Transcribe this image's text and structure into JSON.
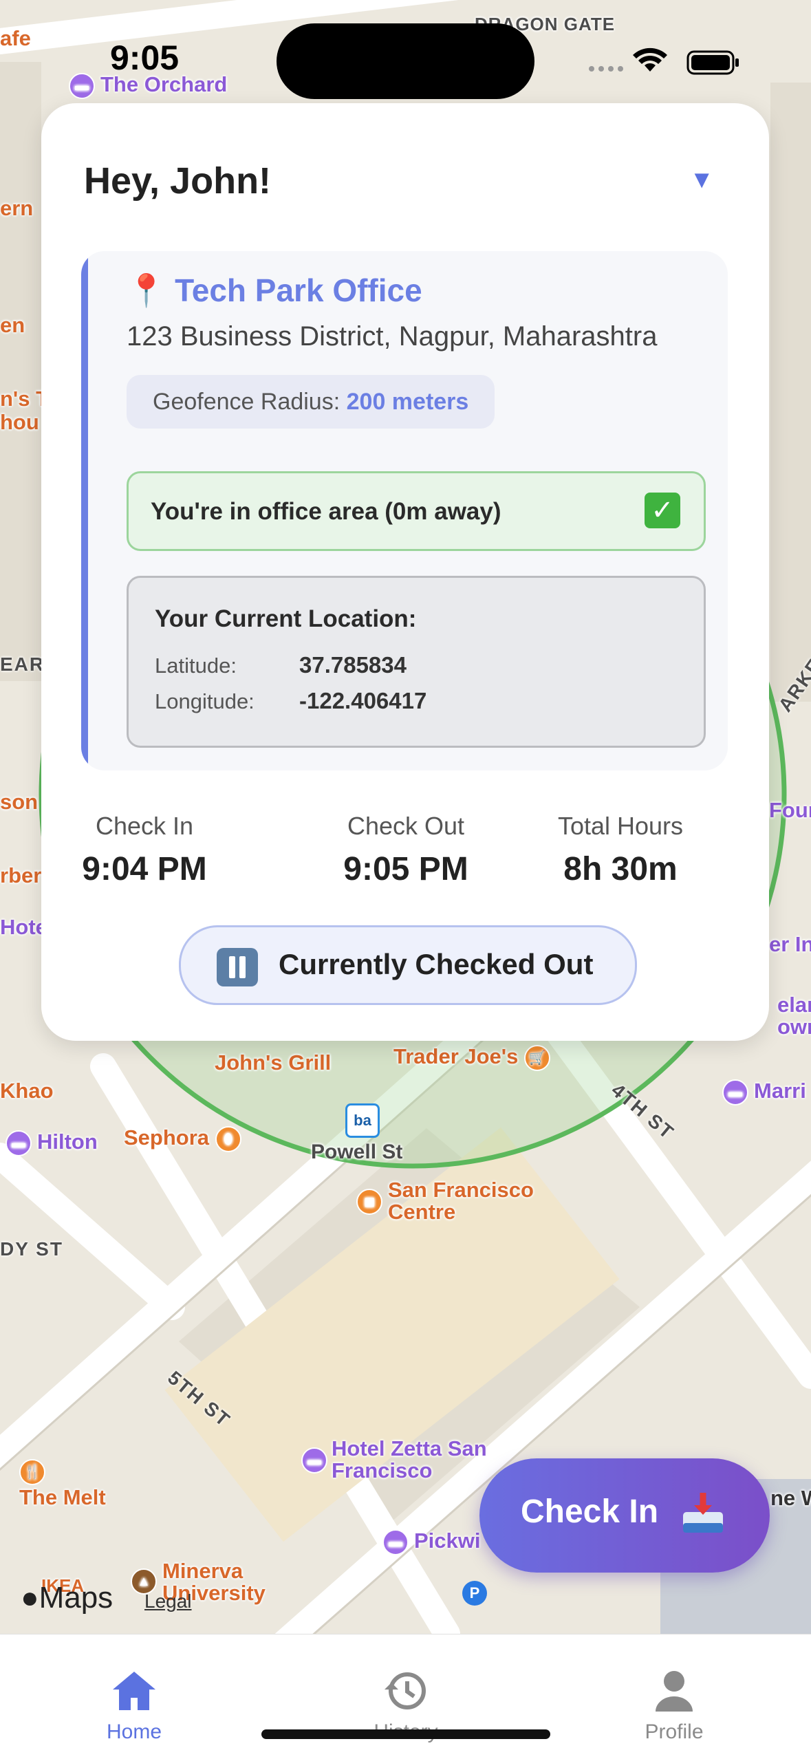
{
  "status_bar": {
    "time": "9:05"
  },
  "map": {
    "labels": {
      "dragon_gate": "DRAGON GATE",
      "the_orchard": "The Orchard",
      "johns_grill": "John's Grill",
      "trader_joes": "Trader Joe's",
      "sephora": "Sephora",
      "powell_st": "Powell St",
      "sf_centre": "San Francisco Centre",
      "hilton": "Hilton",
      "hotel_zetta": "Hotel Zetta San Francisco",
      "the_melt": "The Melt",
      "minerva": "Minerva University",
      "ikea": "IKEA",
      "pickwick": "Pickwi",
      "fourth_st": "4TH ST",
      "fifth_st": "5TH ST",
      "khao": "Khao",
      "marriott": "Marri",
      "four": "Four",
      "cafe": "afe",
      "ern": "ern",
      "en": "en",
      "hts": "n's T",
      "hou": "hou",
      "ear": "EAR",
      "arke": "ARKE",
      "son": "son",
      "rber": "rber",
      "hote": "Hote",
      "erin": "er In",
      "elaro": "elaro",
      "owntc": "owntc",
      "dy_st": "DY ST",
      "me_w": "ne W"
    },
    "maps_brand": "Maps",
    "legal": "Legal"
  },
  "card": {
    "greeting": "Hey, John!",
    "office": {
      "name": "Tech Park Office",
      "address": "123 Business District, Nagpur, Maharashtra",
      "radius_label": "Geofence Radius:",
      "radius_value": "200 meters"
    },
    "geofence_status": "You're in office area (0m away)",
    "current_location": {
      "title": "Your Current Location:",
      "latitude_label": "Latitude:",
      "latitude_value": "37.785834",
      "longitude_label": "Longitude:",
      "longitude_value": "-122.406417"
    },
    "stats": {
      "check_in_label": "Check In",
      "check_in_value": "9:04 PM",
      "check_out_label": "Check Out",
      "check_out_value": "9:05 PM",
      "total_hours_label": "Total Hours",
      "total_hours_value": "8h 30m"
    },
    "status_text": "Currently Checked Out"
  },
  "check_in_button": {
    "label": "Check In"
  },
  "tabs": [
    {
      "label": "Home",
      "icon": "home-icon",
      "active": true
    },
    {
      "label": "History",
      "icon": "history-icon",
      "active": false
    },
    {
      "label": "Profile",
      "icon": "profile-icon",
      "active": false
    }
  ],
  "colors": {
    "accent": "#6b7fe3",
    "geofence": "#5cb85c",
    "button_start": "#6a6ee0",
    "button_end": "#7b4fc9"
  }
}
